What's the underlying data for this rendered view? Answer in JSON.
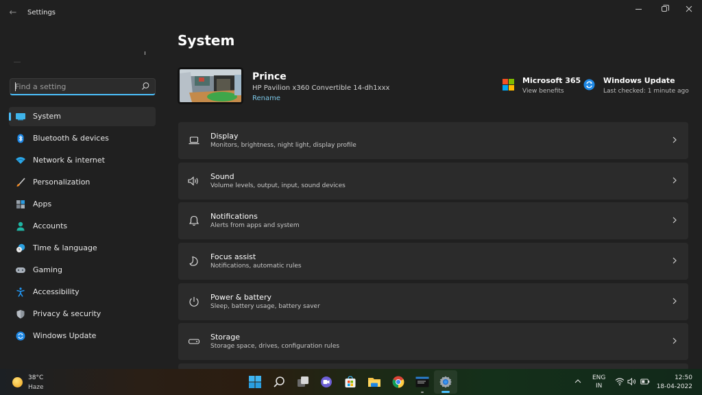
{
  "window": {
    "app_title": "Settings",
    "controls": {
      "minimize": "minimize",
      "maximize": "restore",
      "close": "close"
    }
  },
  "sidebar": {
    "search": {
      "placeholder": "Find a setting",
      "value": ""
    },
    "items": [
      {
        "label": "System",
        "icon": "system-icon",
        "active": true
      },
      {
        "label": "Bluetooth & devices",
        "icon": "bluetooth-icon",
        "active": false
      },
      {
        "label": "Network & internet",
        "icon": "wifi-icon",
        "active": false
      },
      {
        "label": "Personalization",
        "icon": "brush-icon",
        "active": false
      },
      {
        "label": "Apps",
        "icon": "apps-icon",
        "active": false
      },
      {
        "label": "Accounts",
        "icon": "account-icon",
        "active": false
      },
      {
        "label": "Time & language",
        "icon": "time-language-icon",
        "active": false
      },
      {
        "label": "Gaming",
        "icon": "gamepad-icon",
        "active": false
      },
      {
        "label": "Accessibility",
        "icon": "accessibility-icon",
        "active": false
      },
      {
        "label": "Privacy & security",
        "icon": "shield-icon",
        "active": false
      },
      {
        "label": "Windows Update",
        "icon": "windows-update-icon",
        "active": false
      }
    ]
  },
  "main": {
    "title": "System",
    "device": {
      "name": "Prince",
      "model": "HP Pavilion x360 Convertible 14-dh1xxx",
      "rename_label": "Rename"
    },
    "promos": [
      {
        "title": "Microsoft 365",
        "subtitle": "View benefits",
        "icon": "microsoft-logo-icon"
      },
      {
        "title": "Windows Update",
        "subtitle": "Last checked: 1 minute ago",
        "icon": "windows-update-icon"
      }
    ],
    "cards": [
      {
        "title": "Display",
        "subtitle": "Monitors, brightness, night light, display profile",
        "icon": "laptop-icon"
      },
      {
        "title": "Sound",
        "subtitle": "Volume levels, output, input, sound devices",
        "icon": "speaker-icon"
      },
      {
        "title": "Notifications",
        "subtitle": "Alerts from apps and system",
        "icon": "bell-icon"
      },
      {
        "title": "Focus assist",
        "subtitle": "Notifications, automatic rules",
        "icon": "moon-icon"
      },
      {
        "title": "Power & battery",
        "subtitle": "Sleep, battery usage, battery saver",
        "icon": "power-icon"
      },
      {
        "title": "Storage",
        "subtitle": "Storage space, drives, configuration rules",
        "icon": "storage-drive-icon"
      }
    ]
  },
  "taskbar": {
    "weather": {
      "temperature": "38°C",
      "condition": "Haze"
    },
    "apps": [
      {
        "name": "start",
        "icon": "windows-start-icon"
      },
      {
        "name": "search",
        "icon": "search-icon"
      },
      {
        "name": "task-view",
        "icon": "task-view-icon"
      },
      {
        "name": "chat",
        "icon": "teams-chat-icon"
      },
      {
        "name": "microsoft-store",
        "icon": "store-icon"
      },
      {
        "name": "file-explorer",
        "icon": "folder-icon"
      },
      {
        "name": "chrome",
        "icon": "chrome-icon"
      },
      {
        "name": "terminal",
        "icon": "terminal-icon",
        "running": true
      },
      {
        "name": "settings",
        "icon": "settings-gear-icon",
        "active": true
      }
    ],
    "tray": {
      "language_line1": "ENG",
      "language_line2": "IN",
      "time": "12:50",
      "date": "18-04-2022"
    }
  },
  "colors": {
    "accent": "#4cc2ff",
    "background": "#202020",
    "card": "#2b2b2b",
    "link": "#7cc8e8"
  }
}
